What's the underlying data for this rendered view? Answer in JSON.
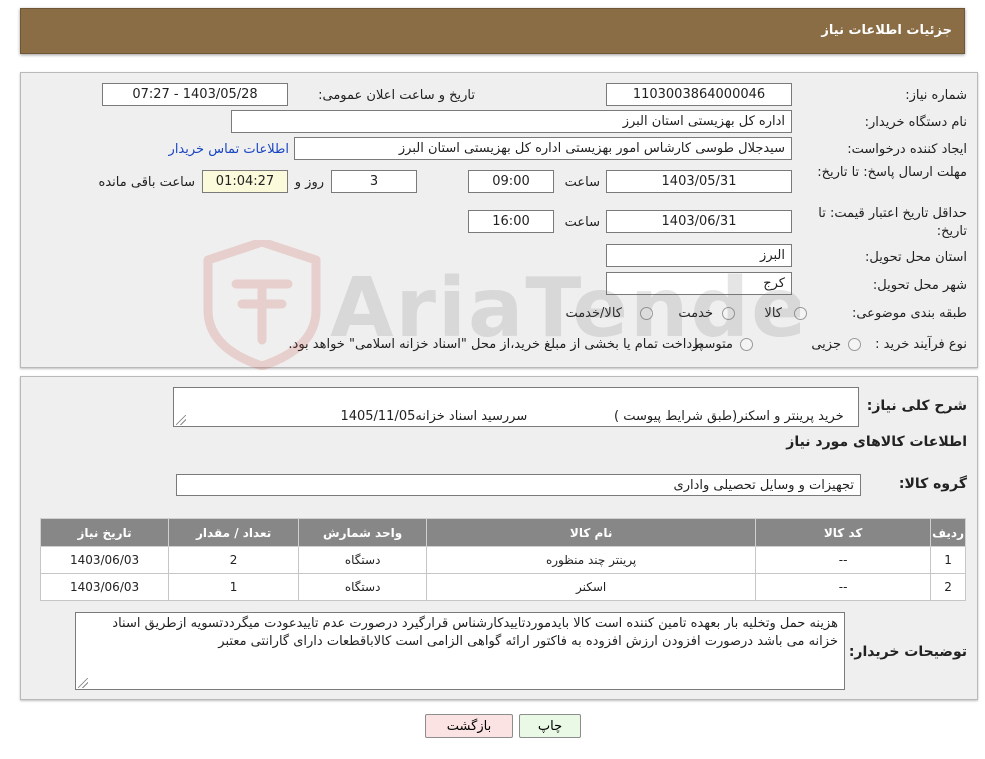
{
  "header": {
    "title": "جزئیات اطلاعات نیاز"
  },
  "form": {
    "need_number_label": "شماره نیاز:",
    "need_number": "1103003864000046",
    "announce_label": "تاریخ و ساعت اعلان عمومی:",
    "announce_value": "1403/05/28 - 07:27",
    "buyer_org_label": "نام دستگاه خریدار:",
    "buyer_org": "اداره کل بهزیستی استان البرز",
    "creator_label": "ایجاد کننده درخواست:",
    "creator": "سیدجلال طوسی کارشاس امور بهزیستی اداره کل بهزیستی استان البرز",
    "contact_link": "اطلاعات تماس خریدار",
    "deadline_label": "مهلت ارسال پاسخ: تا تاریخ:",
    "deadline_date": "1403/05/31",
    "time_label": "ساعت",
    "deadline_time": "09:00",
    "days_value": "3",
    "days_label": "روز و",
    "remaining_time": "01:04:27",
    "remaining_label": "ساعت باقی مانده",
    "validity_label": "حداقل تاریخ اعتبار قیمت: تا تاریخ:",
    "validity_date": "1403/06/31",
    "validity_time": "16:00",
    "province_label": "استان محل تحویل:",
    "province": "البرز",
    "city_label": "شهر محل تحویل:",
    "city": "کرج",
    "category_label": "طبقه بندی موضوعی:",
    "category_options": [
      "کالا",
      "خدمت",
      "کالا/خدمت"
    ],
    "process_label": "نوع فرآیند خرید :",
    "process_options": [
      "جزیی",
      "متوسط"
    ],
    "process_note": "پرداخت تمام یا بخشی از مبلغ خرید،از محل \"اسناد خزانه اسلامی\" خواهد بود."
  },
  "details": {
    "summary_label": "شرح کلی نیاز:",
    "summary_text": "خرید پرینتر و اسکنر(طبق شرایط پیوست )                     سررسید اسناد خزانه1405/11/05",
    "goods_heading": "اطلاعات کالاهای مورد نیاز",
    "goods_group_label": "گروه کالا:",
    "goods_group": "تجهیزات و وسایل تحصیلی واداری",
    "table": {
      "headers": [
        "ردیف",
        "کد کالا",
        "نام کالا",
        "واحد شمارش",
        "تعداد / مقدار",
        "تاریخ نیاز"
      ],
      "rows": [
        [
          "1",
          "--",
          "پرینتر چند منظوره",
          "دستگاه",
          "2",
          "1403/06/03"
        ],
        [
          "2",
          "--",
          "اسکنر",
          "دستگاه",
          "1",
          "1403/06/03"
        ]
      ]
    },
    "buyer_notes_label": "توضیحات خریدار:",
    "buyer_notes": "هزینه حمل وتخلیه بار بعهده تامین کننده است کالا بایدموردتاییدکارشناس قرارگیرد درصورت عدم تاییدعودت میگرددتسویه ازطریق اسناد خزانه می باشد درصورت افزودن ارزش افزوده به فاکتور ارائه گواهی الزامی است کالاباقطعات دارای گارانتی معتبر"
  },
  "buttons": {
    "print": "چاپ",
    "back": "بازگشت"
  },
  "watermark": {
    "text": "AriaTender.neT"
  },
  "colors": {
    "header": "#8a6d45",
    "table_header": "#878787",
    "link": "#1a46c2",
    "back_button": "#fbe3e3",
    "print_button": "#eaf8e6"
  }
}
